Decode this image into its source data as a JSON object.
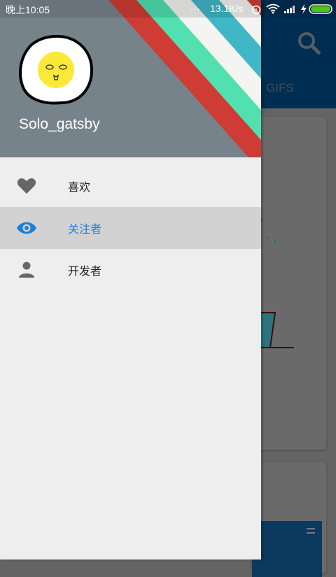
{
  "status_bar": {
    "time": "晚上10:05",
    "net_speed": "13.1K/s",
    "dots": "...",
    "battery_color": "#4cc414"
  },
  "app_bar": {
    "tab_label": "GIFS",
    "search_icon": "search-icon",
    "color": "#002e52"
  },
  "drawer": {
    "username": "Solo_gatsby",
    "header_color": "#77838b",
    "stripe_colors": [
      "#cf3c35",
      "#52e0b0",
      "#f4f4f2",
      "#40b7c6",
      "#f4f4f2",
      "#cf3c35"
    ],
    "items": [
      {
        "label": "喜欢",
        "icon": "heart-icon",
        "active": false
      },
      {
        "label": "关注者",
        "icon": "eye-icon",
        "active": true
      },
      {
        "label": "开发者",
        "icon": "person-icon",
        "active": false
      }
    ],
    "active_color": "#1a7fd6"
  }
}
